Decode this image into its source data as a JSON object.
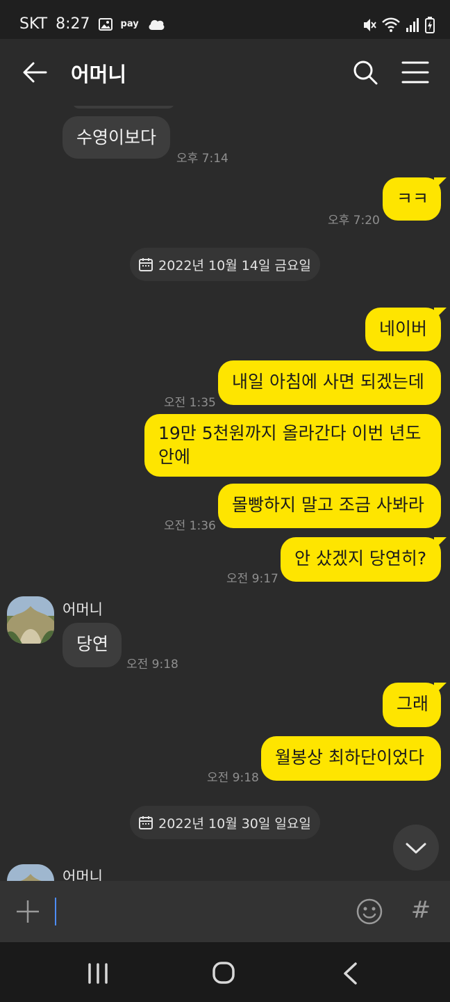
{
  "status": {
    "carrier": "SKT",
    "time": "8:27",
    "pay_label": "pay"
  },
  "header": {
    "title": "어머니"
  },
  "messages": {
    "m1": {
      "text": "수영이보다",
      "time": "오후 7:14"
    },
    "m2": {
      "text": "ㅋㅋ",
      "time": "오후 7:20"
    },
    "date1": "2022년 10월 14일 금요일",
    "m3": {
      "text": "네이버"
    },
    "m4": {
      "text": "내일 아침에 사면 되겠는데",
      "time": "오전 1:35"
    },
    "m5": {
      "text": "19만 5천원까지 올라간다 이번 년도 안에"
    },
    "m6": {
      "text": "몰빵하지 말고 조금 사봐라",
      "time": "오전 1:36"
    },
    "m7": {
      "text": "안 샀겠지 당연히?",
      "time": "오전 9:17"
    },
    "sender1": "어머니",
    "m8": {
      "text": "당연",
      "time": "오전 9:18"
    },
    "m9": {
      "text": "그래"
    },
    "m10": {
      "text": "월봉상 최하단이었다",
      "time": "오전 9:18"
    },
    "date2": "2022년 10월 30일 일요일",
    "sender2": "어머니"
  },
  "input": {
    "value": "",
    "hash_label": "#"
  },
  "colors": {
    "my_bubble": "#fee500",
    "other_bubble": "#3d3d3d",
    "background": "#2b2b2b",
    "caret": "#4d8dff"
  },
  "icons": [
    "back-arrow-icon",
    "search-icon",
    "menu-icon",
    "calendar-icon",
    "chevron-down-icon",
    "plus-icon",
    "emoji-icon",
    "hash-icon",
    "recent-apps-icon",
    "home-icon",
    "nav-back-icon",
    "gallery-icon",
    "cloud-icon",
    "mute-icon",
    "wifi-icon",
    "signal-icon",
    "battery-icon"
  ]
}
